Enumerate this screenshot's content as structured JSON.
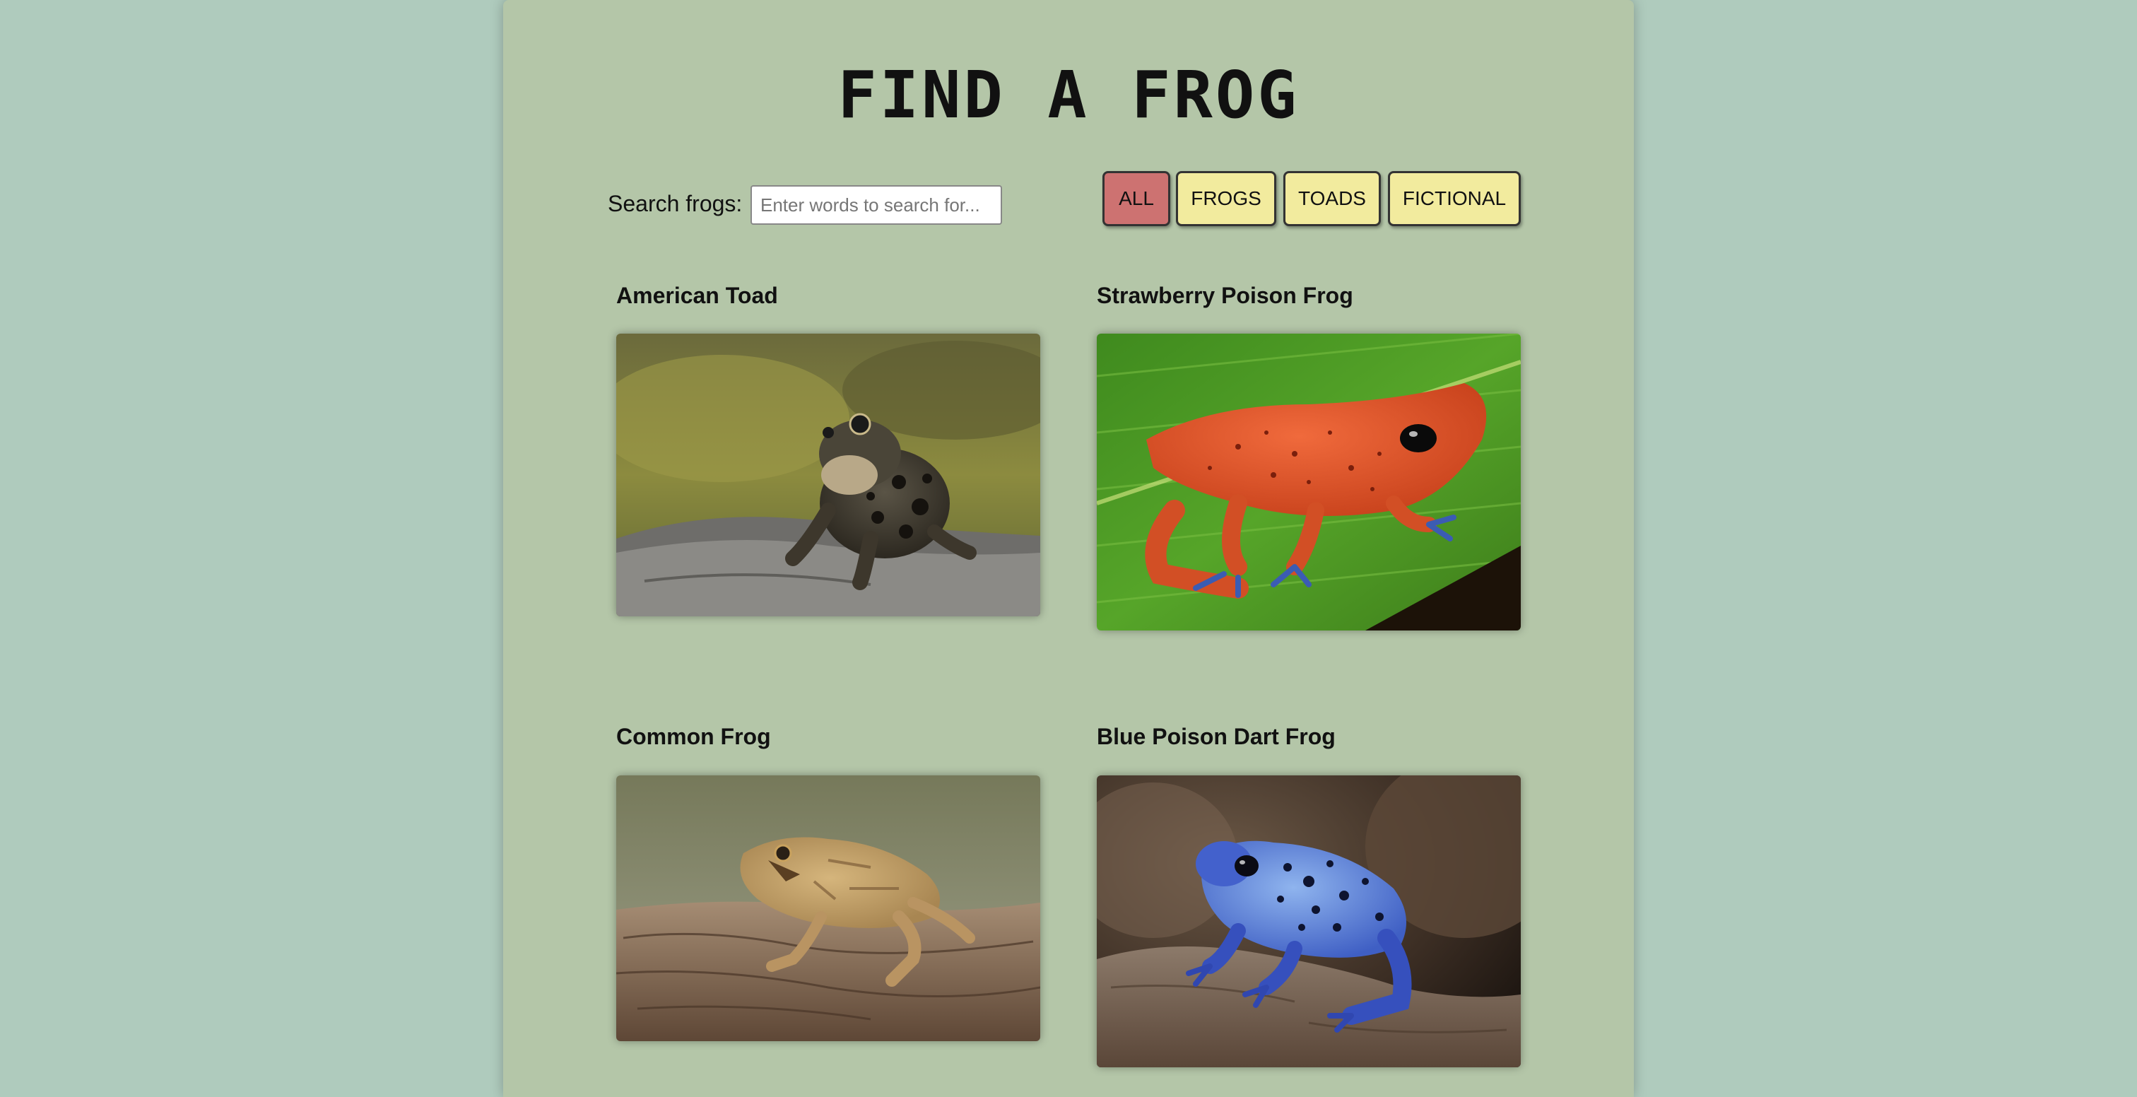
{
  "header": {
    "title": "FIND A FROG"
  },
  "search": {
    "label": "Search frogs:",
    "placeholder": "Enter words to search for...",
    "value": ""
  },
  "filters": [
    {
      "label": "ALL",
      "active": true
    },
    {
      "label": "FROGS",
      "active": false
    },
    {
      "label": "TOADS",
      "active": false
    },
    {
      "label": "FICTIONAL",
      "active": false
    }
  ],
  "frogs": [
    {
      "name": "American Toad"
    },
    {
      "name": "Strawberry Poison Frog"
    },
    {
      "name": "Common Frog"
    },
    {
      "name": "Blue Poison Dart Frog"
    }
  ],
  "colors": {
    "page_background": "#afcbbd",
    "panel_background": "#b4c6a8",
    "button_background": "#f2eb9e",
    "active_button_background": "#cd7271"
  }
}
